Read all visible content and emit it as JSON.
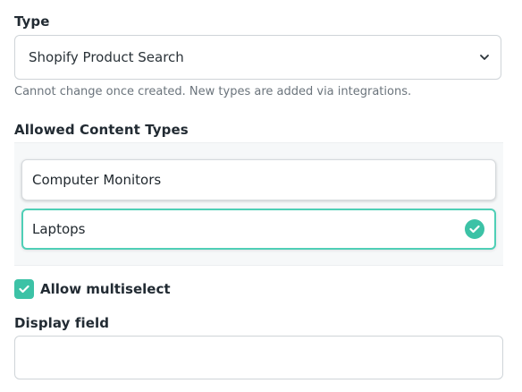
{
  "type_field": {
    "label": "Type",
    "selected_value": "Shopify Product Search",
    "help_text": "Cannot change once created. New types are added via integrations."
  },
  "allowed_content_types": {
    "label": "Allowed Content Types",
    "items": [
      {
        "label": "Computer Monitors",
        "selected": false
      },
      {
        "label": "Laptops",
        "selected": true
      }
    ]
  },
  "allow_multiselect": {
    "label": "Allow multiselect",
    "checked": true
  },
  "display_field": {
    "label": "Display field",
    "value": ""
  },
  "colors": {
    "accent": "#3cc2a6",
    "selected_border": "#4fcfb6"
  },
  "icons": {
    "select_chevron": "chevron-down-icon",
    "selected_mark": "check-circle-icon",
    "checkbox_mark": "checkmark-icon"
  }
}
